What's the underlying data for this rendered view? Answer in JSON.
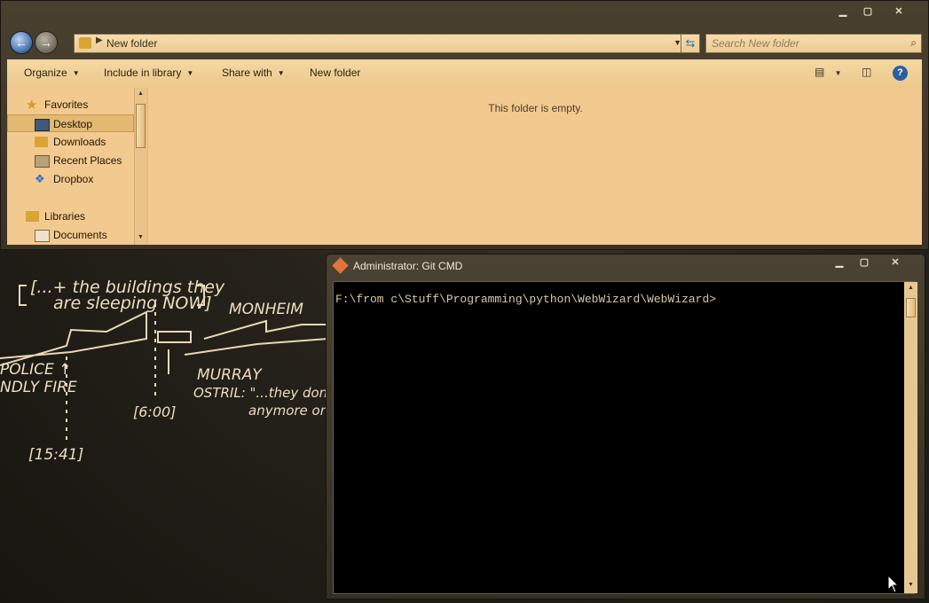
{
  "explorer": {
    "address_path": "New folder",
    "search_placeholder": "Search New folder",
    "toolbar": {
      "organize": "Organize",
      "include_in_library": "Include in library",
      "share_with": "Share with",
      "new_folder": "New folder"
    },
    "nav": {
      "favorites": "Favorites",
      "desktop": "Desktop",
      "downloads": "Downloads",
      "recent_places": "Recent Places",
      "dropbox": "Dropbox",
      "libraries": "Libraries",
      "documents": "Documents"
    },
    "empty_message": "This folder is empty."
  },
  "cmd": {
    "title": "Administrator: Git CMD",
    "prompt": "F:\\from c\\Stuff\\Programming\\python\\WebWizard\\WebWizard>"
  },
  "wallpaper_text": {
    "line1": "[...+ the buildings they",
    "line2": "are sleeping NOW]",
    "monheim": "MONHEIM",
    "police": "POLICE ↑",
    "friendly_fire": "NDLY FIRE",
    "murray": "MURRAY",
    "ostril": "OSTRIL: \"...they don't",
    "anymore": "anymore on th",
    "time1": "[15:41]",
    "time2": "[6:00]"
  },
  "colors": {
    "explorer_body": "#f2c98e",
    "toolbar": "#efcf96",
    "chrome": "#3f3628",
    "console_bg": "#000000",
    "console_text": "#d8c8a6"
  }
}
